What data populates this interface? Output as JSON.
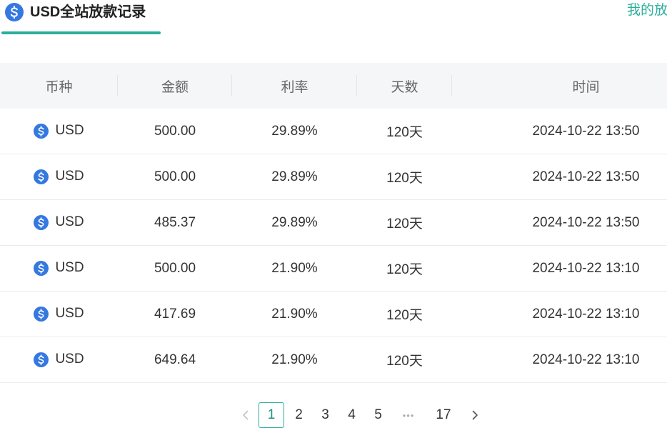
{
  "tabs": {
    "active": {
      "icon": "dollar-coin-icon",
      "label": "USD全站放款记录"
    },
    "other": {
      "label": "我的放"
    }
  },
  "table": {
    "columns": [
      "币种",
      "金额",
      "利率",
      "天数",
      "时间"
    ],
    "rows": [
      {
        "currency_icon": "dollar-coin-icon",
        "currency": "USD",
        "amount": "500.00",
        "rate": "29.89%",
        "days": "120天",
        "time": "2024-10-22 13:50"
      },
      {
        "currency_icon": "dollar-coin-icon",
        "currency": "USD",
        "amount": "500.00",
        "rate": "29.89%",
        "days": "120天",
        "time": "2024-10-22 13:50"
      },
      {
        "currency_icon": "dollar-coin-icon",
        "currency": "USD",
        "amount": "485.37",
        "rate": "29.89%",
        "days": "120天",
        "time": "2024-10-22 13:50"
      },
      {
        "currency_icon": "dollar-coin-icon",
        "currency": "USD",
        "amount": "500.00",
        "rate": "21.90%",
        "days": "120天",
        "time": "2024-10-22 13:10"
      },
      {
        "currency_icon": "dollar-coin-icon",
        "currency": "USD",
        "amount": "417.69",
        "rate": "21.90%",
        "days": "120天",
        "time": "2024-10-22 13:10"
      },
      {
        "currency_icon": "dollar-coin-icon",
        "currency": "USD",
        "amount": "649.64",
        "rate": "21.90%",
        "days": "120天",
        "time": "2024-10-22 13:10"
      }
    ]
  },
  "pagination": {
    "prev_icon": "chevron-left-icon",
    "pages": [
      "1",
      "2",
      "3",
      "4",
      "5"
    ],
    "current": "1",
    "ellipsis": "•••",
    "last_page": "17",
    "next_icon": "chevron-right-icon"
  },
  "colors": {
    "accent": "#2aae9c",
    "coin": "#3478e0",
    "text": "#333333",
    "muted": "#666666"
  }
}
